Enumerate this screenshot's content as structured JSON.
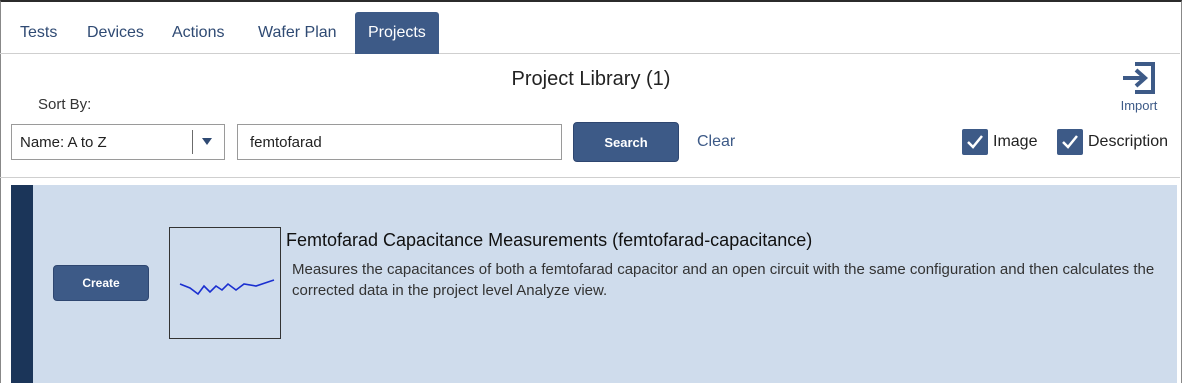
{
  "tabs": [
    {
      "label": "Tests",
      "active": false
    },
    {
      "label": "Devices",
      "active": false
    },
    {
      "label": "Actions",
      "active": false
    },
    {
      "label": "Wafer Plan",
      "active": false
    },
    {
      "label": "Projects",
      "active": true
    }
  ],
  "header": {
    "title": "Project Library (1)",
    "sort_by_label": "Sort By:",
    "sort_value": "Name: A to Z",
    "search_value": "femtofarad",
    "search_button": "Search",
    "clear_link": "Clear",
    "import_label": "Import",
    "show_image_label": "Image",
    "show_image_checked": true,
    "show_description_label": "Description",
    "show_description_checked": true
  },
  "results": [
    {
      "create_button": "Create",
      "title": "Femtofarad Capacitance Measurements (femtofarad-capacitance)",
      "description": "Measures the capacitances of both a femtofarad capacitor and an open circuit with the same configuration and then calculates the corrected data in the project level Analyze view.",
      "thumbnail_icon": "capacitor-waveform-icon"
    }
  ],
  "colors": {
    "accent": "#3d5a87",
    "stripe": "#1b3559",
    "result_bg": "#cfdcec"
  }
}
